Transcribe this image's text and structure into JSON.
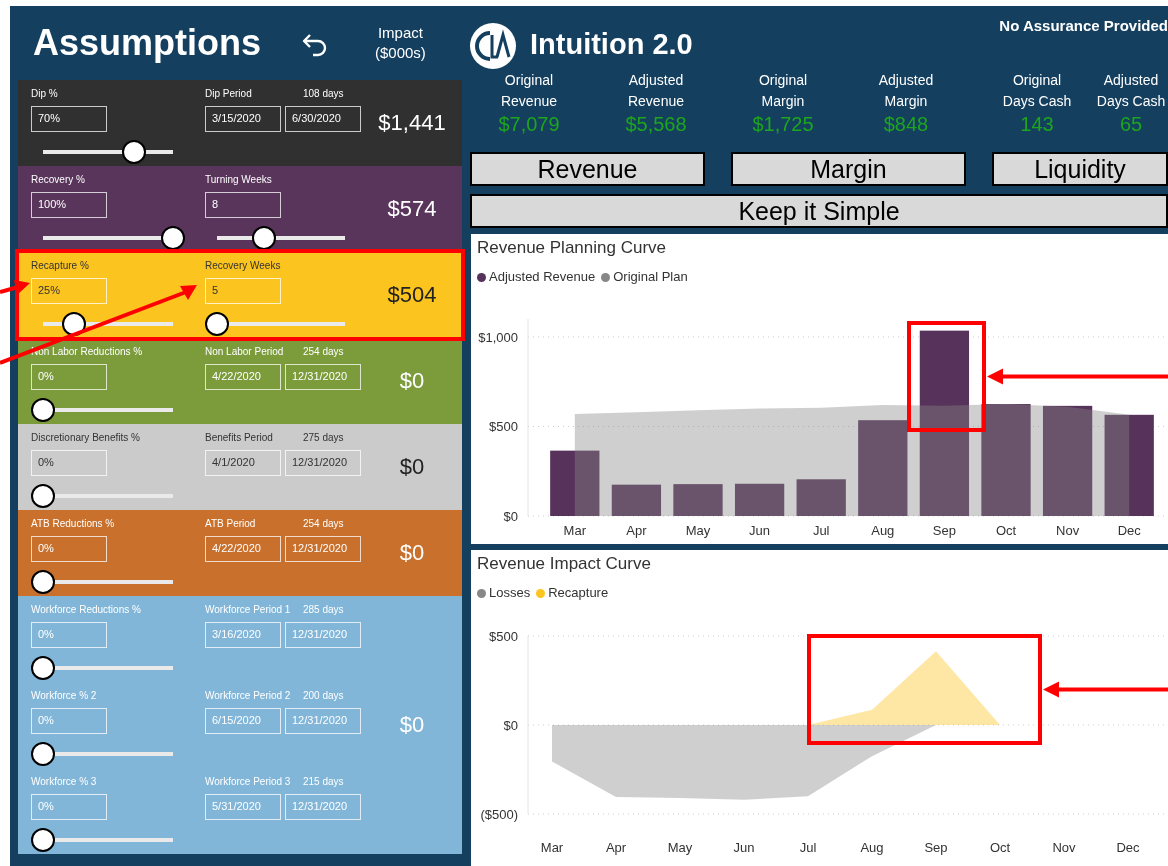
{
  "assumptions": {
    "title": "Assumptions",
    "impact_header": "Impact\n($000s)",
    "sections": [
      {
        "color": "#303030",
        "impact": "$1,441",
        "highlighted": false,
        "rows": [
          {
            "label": "Dip %",
            "value": "70%",
            "level": 0.7,
            "right": {
              "kind": "period",
              "label": "Dip Period",
              "days": "108 days",
              "start": "3/15/2020",
              "end": "6/30/2020"
            }
          }
        ]
      },
      {
        "color": "#59355b",
        "impact": "$574",
        "highlighted": false,
        "rows": [
          {
            "label": "Recovery %",
            "value": "100%",
            "level": 1,
            "right": {
              "kind": "slider",
              "label": "Turning Weeks",
              "value": "8",
              "level": 0.37
            }
          }
        ]
      },
      {
        "color": "#fcc41e",
        "impact": "$504",
        "highlighted": true,
        "rows": [
          {
            "label": "Recapture %",
            "value": "25%",
            "level": 0.24,
            "right": {
              "kind": "slider",
              "label": "Recovery Weeks",
              "value": "5",
              "level": 0
            }
          }
        ]
      },
      {
        "color": "#7c9c3c",
        "impact": "$0",
        "highlighted": false,
        "rows": [
          {
            "label": "Non Labor Reductions %",
            "value": "0%",
            "level": 0,
            "right": {
              "kind": "period",
              "label": "Non Labor Period",
              "days": "254 days",
              "start": "4/22/2020",
              "end": "12/31/2020"
            }
          }
        ]
      },
      {
        "color": "#cbcbcb",
        "impact": "$0",
        "highlighted": false,
        "rows": [
          {
            "label": "Discretionary Benefits %",
            "value": "0%",
            "level": 0,
            "right": {
              "kind": "period",
              "label": "Benefits Period",
              "days": "275 days",
              "start": "4/1/2020",
              "end": "12/31/2020"
            }
          }
        ]
      },
      {
        "color": "#c8702c",
        "impact": "$0",
        "highlighted": false,
        "rows": [
          {
            "label": "ATB Reductions %",
            "value": "0%",
            "level": 0,
            "right": {
              "kind": "period",
              "label": "ATB Period",
              "days": "254 days",
              "start": "4/22/2020",
              "end": "12/31/2020"
            }
          }
        ]
      },
      {
        "color": "#82b6d9",
        "impact": "$0",
        "highlighted": false,
        "rows": [
          {
            "label": "Workforce Reductions %",
            "value": "0%",
            "level": 0,
            "right": {
              "kind": "period",
              "label": "Workforce Period 1",
              "days": "285 days",
              "start": "3/16/2020",
              "end": "12/31/2020"
            }
          },
          {
            "label": "Workforce % 2",
            "value": "0%",
            "level": 0,
            "right": {
              "kind": "period",
              "label": "Workforce Period 2",
              "days": "200 days",
              "start": "6/15/2020",
              "end": "12/31/2020"
            }
          },
          {
            "label": "Workforce % 3",
            "value": "0%",
            "level": 0,
            "right": {
              "kind": "period",
              "label": "Workforce Period 3",
              "days": "215 days",
              "start": "5/31/2020",
              "end": "12/31/2020"
            }
          }
        ]
      }
    ]
  },
  "header": {
    "app_title": "Intuition 2.0",
    "notice": "No Assurance Provided"
  },
  "kpis": [
    {
      "label": "Original\nRevenue",
      "value": "$7,079"
    },
    {
      "label": "Adjusted\nRevenue",
      "value": "$5,568"
    },
    {
      "label": "Original\nMargin",
      "value": "$1,725"
    },
    {
      "label": "Adjusted\nMargin",
      "value": "$848"
    },
    {
      "label": "Original\nDays Cash",
      "value": "143"
    },
    {
      "label": "Adjusted\nDays Cash",
      "value": "65"
    }
  ],
  "nav_buttons": [
    "Revenue",
    "Margin",
    "Liquidity"
  ],
  "simple_button": "Keep it Simple",
  "charts": [
    {
      "chart_data": {
        "type": "bar",
        "title": "Revenue Planning Curve",
        "stacked": false,
        "grid": true,
        "categories": [
          "Mar",
          "Apr",
          "May",
          "Jun",
          "Jul",
          "Aug",
          "Sep",
          "Oct",
          "Nov",
          "Dec"
        ],
        "ylim": [
          0,
          1100
        ],
        "yticks": [
          {
            "value": 0,
            "label": "$0"
          },
          {
            "value": 500,
            "label": "$500"
          },
          {
            "value": 1000,
            "label": "$1,000"
          }
        ],
        "series": [
          {
            "name": "Adjusted Revenue",
            "color": "#57325a",
            "values": [
              365,
              175,
              178,
              180,
              205,
              535,
              1035,
              625,
              615,
              565
            ]
          },
          {
            "name": "Original Plan",
            "color": "#878787",
            "type": "area",
            "values": [
              570,
              580,
              590,
              600,
              605,
              620,
              615,
              625,
              610,
              565
            ]
          }
        ]
      }
    },
    {
      "chart_data": {
        "type": "area",
        "title": "Revenue Impact Curve",
        "stacked": false,
        "grid": true,
        "categories": [
          "Mar",
          "Apr",
          "May",
          "Jun",
          "Jul",
          "Aug",
          "Sep",
          "Oct",
          "Nov",
          "Dec"
        ],
        "ylim": [
          -500,
          500
        ],
        "yticks": [
          {
            "value": -500,
            "label": "($500)"
          },
          {
            "value": 0,
            "label": "$0"
          },
          {
            "value": 500,
            "label": "$500"
          }
        ],
        "series": [
          {
            "name": "Losses",
            "color": "#878787",
            "values": [
              -205,
              -405,
              -410,
              -420,
              -400,
              -175,
              0,
              null,
              null,
              null
            ]
          },
          {
            "name": "Recapture",
            "color": "#fcc41e",
            "values": [
              null,
              null,
              null,
              null,
              0,
              85,
              415,
              0,
              null,
              null
            ]
          }
        ]
      }
    }
  ]
}
